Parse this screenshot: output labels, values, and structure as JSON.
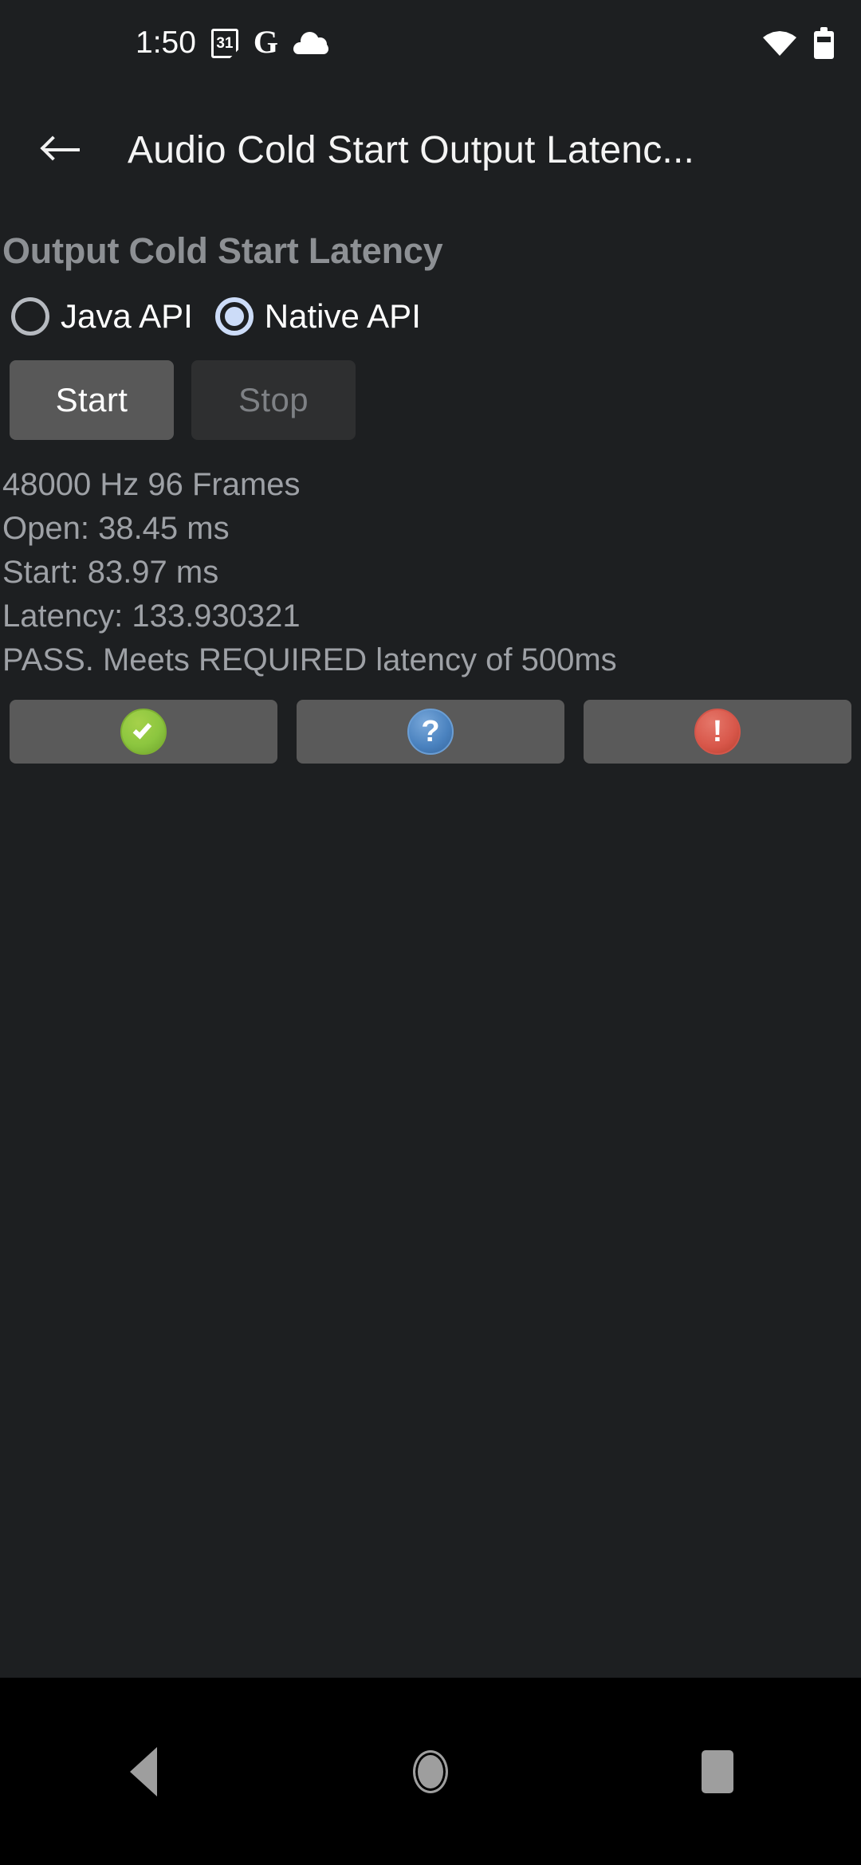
{
  "status_bar": {
    "clock": "1:50",
    "calendar_day": "31",
    "google_glyph": "G",
    "icons": {
      "calendar": "calendar-icon",
      "google": "google-icon",
      "cloud": "cloud-icon",
      "wifi": "wifi-icon",
      "battery": "battery-icon"
    }
  },
  "app_bar": {
    "back_icon": "back-arrow-icon",
    "title": "Audio Cold Start Output Latenc..."
  },
  "main": {
    "section_title": "Output Cold Start Latency",
    "api_options": [
      {
        "label": "Java API",
        "selected": false
      },
      {
        "label": "Native API",
        "selected": true
      }
    ],
    "buttons": {
      "start": "Start",
      "stop": "Stop",
      "start_enabled": true,
      "stop_enabled": false
    },
    "results": [
      "48000 Hz 96 Frames",
      "Open: 38.45 ms",
      "Start: 83.97 ms",
      "Latency: 133.930321",
      "PASS. Meets REQUIRED latency of 500ms"
    ],
    "icon_buttons": [
      {
        "icon": "check-circle-icon",
        "color": "#8cc63f",
        "glyph": ""
      },
      {
        "icon": "question-circle-icon",
        "color": "#4a82bf",
        "glyph": "?"
      },
      {
        "icon": "exclamation-circle-icon",
        "color": "#d8574a",
        "glyph": "!"
      }
    ]
  },
  "nav_bar": {
    "back": "nav-back-icon",
    "home": "nav-home-icon",
    "recents": "nav-recents-icon"
  },
  "colors": {
    "background": "#1d1f21",
    "nav_background": "#000000",
    "title_text": "#f4f4f4",
    "section_text": "#8d9094",
    "result_text": "#9ea1a6",
    "accent_radio": "#ccdcf8",
    "button_enabled": "#585858",
    "button_disabled": "#2e2f30",
    "icon_button_bg": "#5a5a5a"
  }
}
